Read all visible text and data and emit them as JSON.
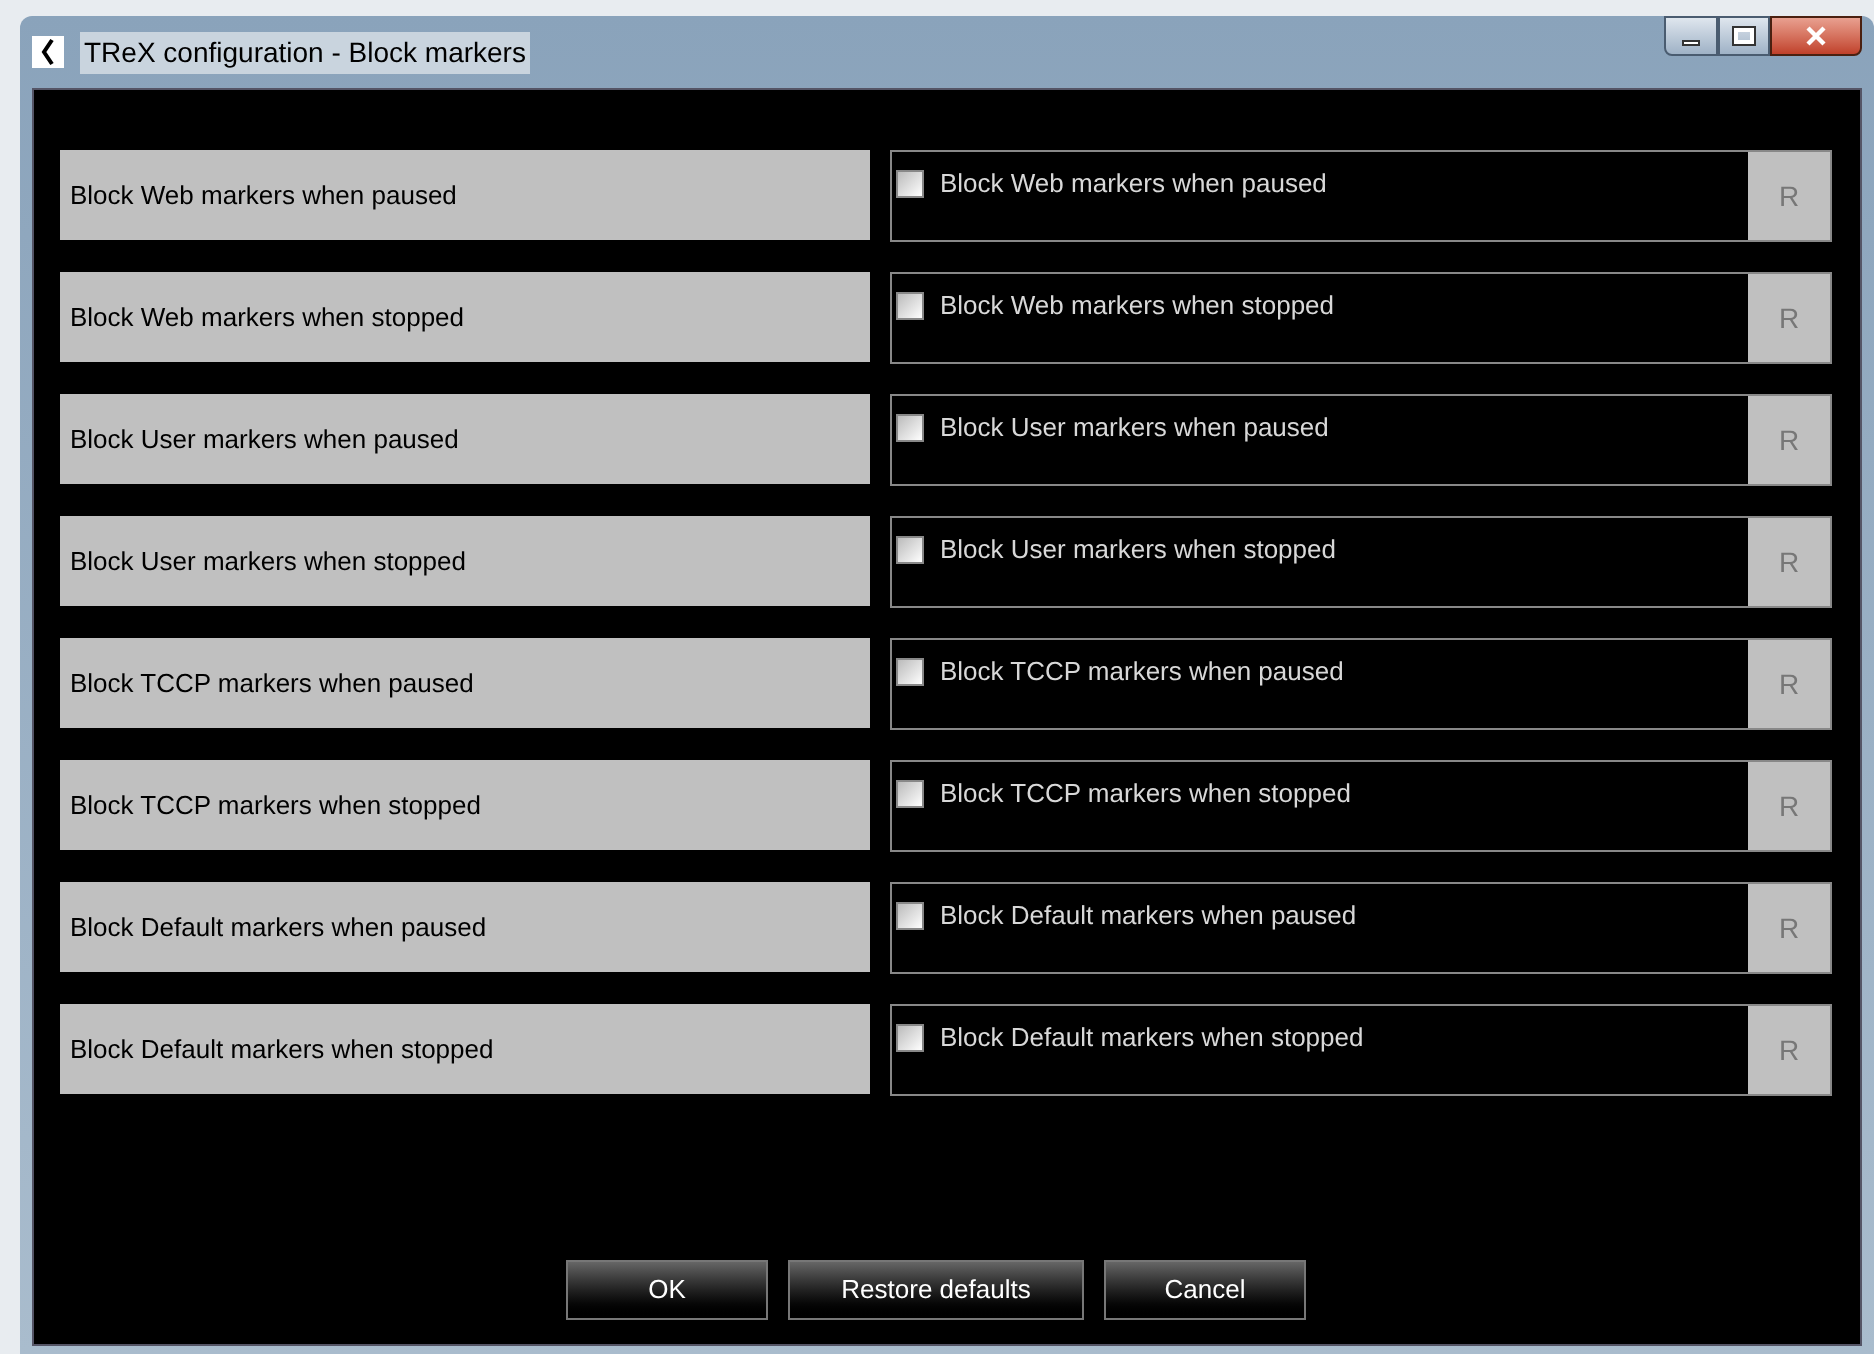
{
  "window": {
    "title": "TReX configuration - Block markers"
  },
  "rows": [
    {
      "label": "Block Web markers when paused",
      "checkbox_label": "Block Web markers when paused",
      "checked": false,
      "reset": "R"
    },
    {
      "label": "Block Web markers when stopped",
      "checkbox_label": "Block Web markers when stopped",
      "checked": false,
      "reset": "R"
    },
    {
      "label": "Block User markers when paused",
      "checkbox_label": "Block User markers when paused",
      "checked": false,
      "reset": "R"
    },
    {
      "label": "Block User markers when stopped",
      "checkbox_label": "Block User markers when stopped",
      "checked": false,
      "reset": "R"
    },
    {
      "label": "Block TCCP markers when paused",
      "checkbox_label": "Block TCCP markers when paused",
      "checked": false,
      "reset": "R"
    },
    {
      "label": "Block TCCP markers when stopped",
      "checkbox_label": "Block TCCP markers when stopped",
      "checked": false,
      "reset": "R"
    },
    {
      "label": "Block Default markers when paused",
      "checkbox_label": "Block Default markers when paused",
      "checked": false,
      "reset": "R"
    },
    {
      "label": "Block Default markers when stopped",
      "checkbox_label": "Block Default markers when stopped",
      "checked": false,
      "reset": "R"
    }
  ],
  "buttons": [
    "OK",
    "Restore defaults",
    "Cancel"
  ]
}
